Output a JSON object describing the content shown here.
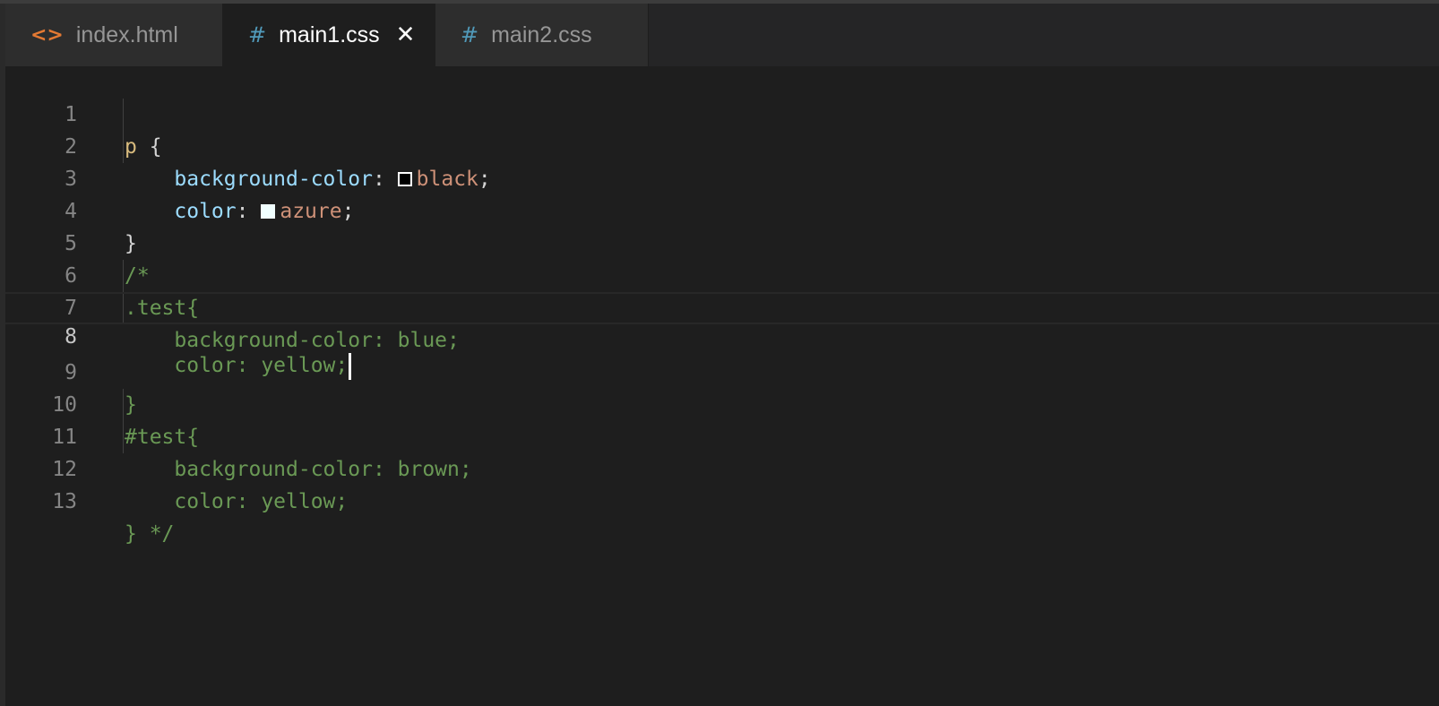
{
  "tabs": [
    {
      "label": "index.html",
      "icon": "<>",
      "icon_name": "html-file-icon",
      "active": false
    },
    {
      "label": "main1.css",
      "icon": "#",
      "icon_name": "css-file-icon",
      "active": true,
      "close": "✕"
    },
    {
      "label": "main2.css",
      "icon": "#",
      "icon_name": "css-file-icon",
      "active": false
    }
  ],
  "colors": {
    "selector": "#d7ba7d",
    "property": "#9cdcfe",
    "value": "#ce9178",
    "comment": "#6a9955",
    "html_icon": "#e37933",
    "css_icon": "#519aba"
  },
  "editor": {
    "current_line": 8,
    "lines": [
      {
        "n": "1",
        "sel": "p",
        "brace": " {"
      },
      {
        "n": "2",
        "indent": "    ",
        "prop": "background-color",
        "colon": ": ",
        "swatch": "black",
        "val": "black",
        "semi": ";"
      },
      {
        "n": "3",
        "indent": "    ",
        "prop": "color",
        "colon": ": ",
        "swatch": "azure",
        "val": "azure",
        "semi": ";"
      },
      {
        "n": "4",
        "brace": "}"
      },
      {
        "n": "5",
        "comment": "/*"
      },
      {
        "n": "6",
        "comment": ".test{"
      },
      {
        "n": "7",
        "comment": "    background-color: blue;"
      },
      {
        "n": "8",
        "comment": "    color: yellow;"
      },
      {
        "n": "9",
        "comment": "}"
      },
      {
        "n": "10",
        "comment": "#test{"
      },
      {
        "n": "11",
        "comment": "    background-color: brown;"
      },
      {
        "n": "12",
        "comment": "    color: yellow;"
      },
      {
        "n": "13",
        "comment": "} */"
      }
    ]
  }
}
